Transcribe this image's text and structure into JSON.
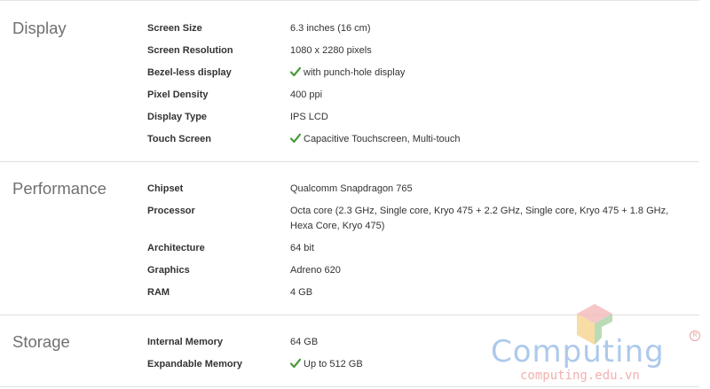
{
  "sections": [
    {
      "title": "Display",
      "rows": [
        {
          "label": "Screen Size",
          "value": "6.3 inches (16 cm)",
          "check": false
        },
        {
          "label": "Screen Resolution",
          "value": "1080 x 2280 pixels",
          "check": false
        },
        {
          "label": "Bezel-less display",
          "value": "with punch-hole display",
          "check": true
        },
        {
          "label": "Pixel Density",
          "value": "400 ppi",
          "check": false
        },
        {
          "label": "Display Type",
          "value": "IPS LCD",
          "check": false
        },
        {
          "label": "Touch Screen",
          "value": "Capacitive Touchscreen, Multi-touch",
          "check": true
        }
      ]
    },
    {
      "title": "Performance",
      "rows": [
        {
          "label": "Chipset",
          "value": "Qualcomm Snapdragon 765",
          "check": false
        },
        {
          "label": "Processor",
          "value": "Octa core (2.3 GHz, Single core, Kryo 475 + 2.2 GHz, Single core, Kryo 475 + 1.8 GHz, Hexa Core, Kryo 475)",
          "check": false
        },
        {
          "label": "Architecture",
          "value": "64 bit",
          "check": false
        },
        {
          "label": "Graphics",
          "value": "Adreno 620",
          "check": false
        },
        {
          "label": "RAM",
          "value": "4 GB",
          "check": false
        }
      ]
    },
    {
      "title": "Storage",
      "rows": [
        {
          "label": "Internal Memory",
          "value": "64 GB",
          "check": false
        },
        {
          "label": "Expandable Memory",
          "value": "Up to 512 GB",
          "check": true
        }
      ]
    }
  ],
  "watermark": {
    "brand": "Computing",
    "site": "computing.edu.vn",
    "registered": "R"
  },
  "colors": {
    "check": "#4a9a3c",
    "divider": "#e0e0e0",
    "section_title": "#707070"
  },
  "icons": {
    "check": "checkmark-icon",
    "logo": "computing-logo-icon"
  }
}
